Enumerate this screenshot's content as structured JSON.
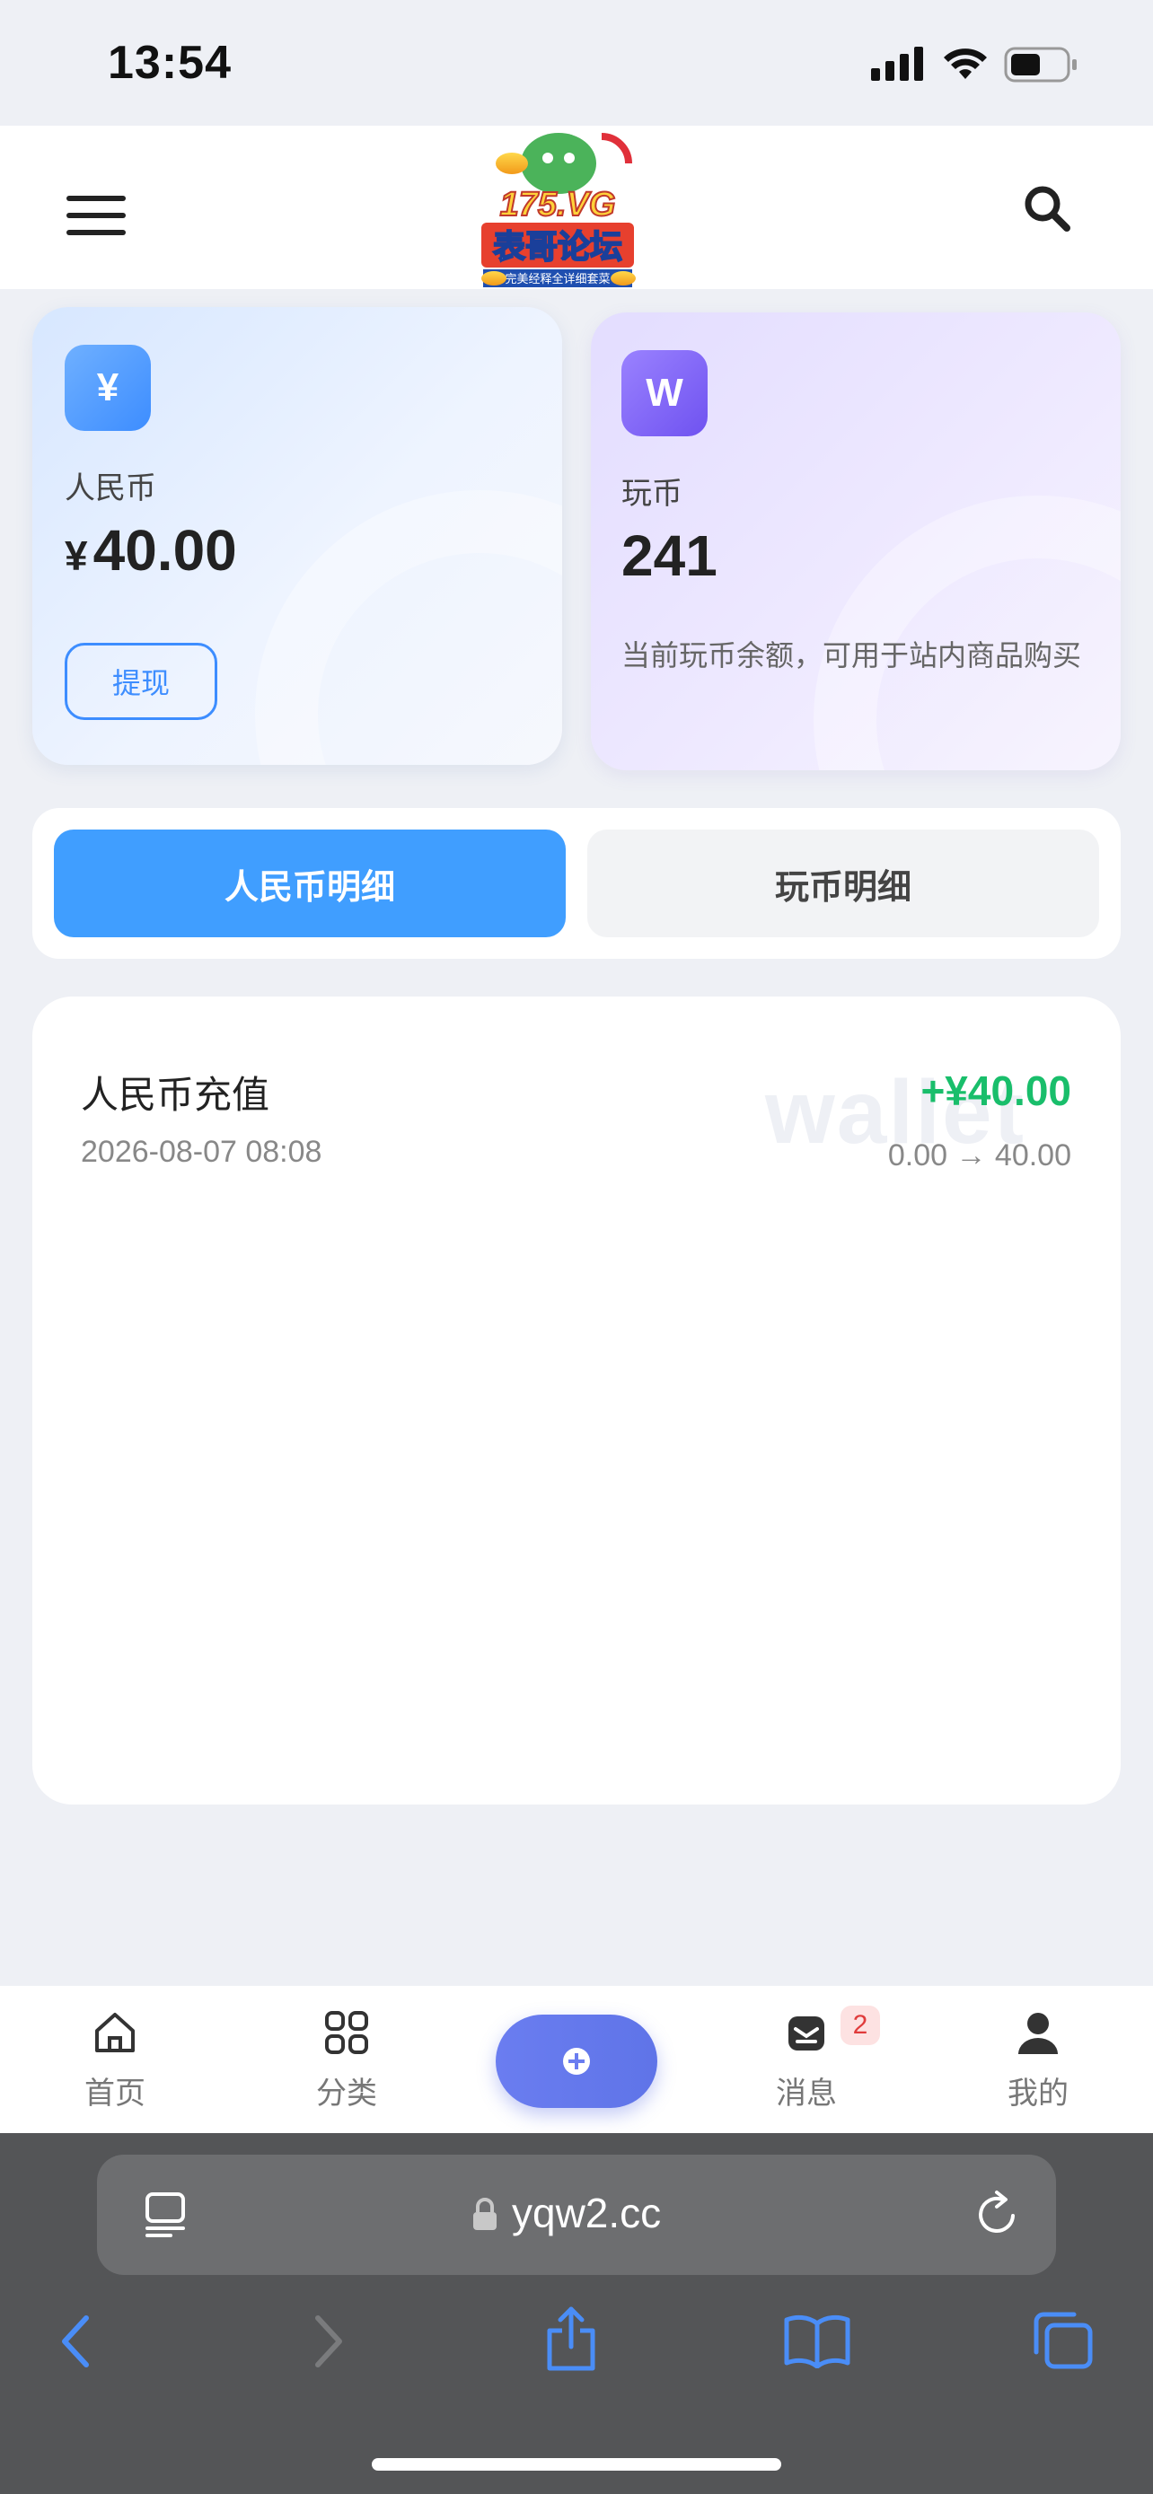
{
  "status_bar": {
    "time": "13:54",
    "signal_icon": "signal-bars-icon",
    "wifi_icon": "wifi-icon",
    "battery_icon": "battery-icon"
  },
  "header": {
    "menu_icon": "hamburger-menu-icon",
    "logo_text": "175.VG 表哥论坛",
    "logo_tagline": "完美经释全详细套菜",
    "search_icon": "search-icon"
  },
  "wallet": {
    "rmb": {
      "icon_glyph": "¥",
      "label": "人民币",
      "currency": "¥",
      "amount": "40.00",
      "withdraw_label": "提现"
    },
    "wanbi": {
      "icon_glyph": "W",
      "label": "玩币",
      "amount": "241",
      "description": "当前玩币余额，可用于站内商品购买"
    }
  },
  "tabs": [
    {
      "label": "人民币明细",
      "active": true
    },
    {
      "label": "玩币明细",
      "active": false
    }
  ],
  "transactions": {
    "watermark": "wallet",
    "items": [
      {
        "title": "人民币充值",
        "date": "2026-08-07 08:08",
        "amount": "+¥40.00",
        "balance_change": "0.00 → 40.00"
      }
    ]
  },
  "bottom_nav": {
    "items": [
      {
        "label": "首页",
        "icon": "home-icon"
      },
      {
        "label": "分类",
        "icon": "grid-icon"
      },
      {
        "label": "消息",
        "icon": "mail-icon",
        "badge": "2"
      },
      {
        "label": "我的",
        "icon": "user-icon"
      }
    ],
    "fab_icon": "plus-circle-icon"
  },
  "browser": {
    "url": "yqw2.cc",
    "lock_icon": "lock-icon",
    "reader_icon": "reader-icon",
    "reload_icon": "reload-icon",
    "back_icon": "back-icon",
    "forward_icon": "forward-icon",
    "share_icon": "share-icon",
    "bookmarks_icon": "bookmarks-icon",
    "tabs_icon": "tabs-icon"
  },
  "colors": {
    "accent": "#409eff",
    "positive": "#19be6b",
    "purple": "#6f52f0",
    "fab": "#6a7df0"
  }
}
